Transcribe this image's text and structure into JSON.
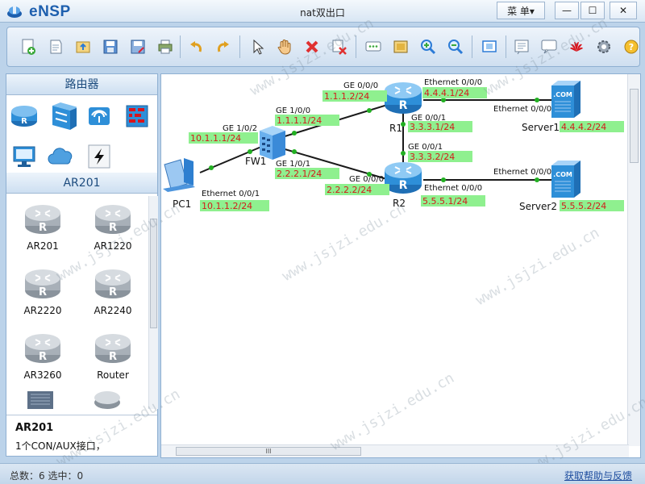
{
  "app": {
    "name": "eNSP",
    "title": "nat双出口",
    "menu_label": "菜 单▾"
  },
  "window_buttons": {
    "minimize": "—",
    "maximize": "☐",
    "close": "✕"
  },
  "toolbar": {
    "icons": [
      "new-topology-icon",
      "new-from-template-icon",
      "open-icon",
      "save-icon",
      "save-as-icon",
      "print-icon",
      "undo-icon",
      "redo-icon",
      "select-icon",
      "pan-hand-icon",
      "delete-icon",
      "delete-link-icon",
      "text-note-icon",
      "palette-icon",
      "zoom-in-icon",
      "zoom-out-icon",
      "fit-window-icon",
      "topology-grid-icon",
      "chat-icon",
      "huawei-icon",
      "settings-icon",
      "help-icon"
    ]
  },
  "left_panel": {
    "category_header": "路由器",
    "categories": [
      "router-category-icon",
      "switch-category-icon",
      "wireless-category-icon",
      "firewall-category-icon",
      "terminal-category-icon",
      "cloud-category-icon",
      "link-category-icon"
    ],
    "device_header": "AR201",
    "devices": [
      {
        "label": "AR201"
      },
      {
        "label": "AR1220"
      },
      {
        "label": "AR2220"
      },
      {
        "label": "AR2240"
      },
      {
        "label": "AR3260"
      },
      {
        "label": "Router"
      }
    ],
    "info_title": "AR201",
    "info_desc": "1个CON/AUX接口，"
  },
  "topology": {
    "nodes": {
      "pc1": "PC1",
      "fw1": "FW1",
      "r1": "R1",
      "r2": "R2",
      "server1": "Server1",
      "server2": "Server2",
      "server_badge": ".COM"
    },
    "interfaces": {
      "pc1_eth": "Ethernet 0/0/1",
      "fw1_ge102": "GE 1/0/2",
      "fw1_ge100": "GE 1/0/0",
      "fw1_ge101": "GE 1/0/1",
      "r1_ge000": "GE 0/0/0",
      "r1_eth000": "Ethernet 0/0/0",
      "r1_ge001": "GE 0/0/1",
      "r2_ge001": "GE 0/0/1",
      "r2_ge000": "GE 0/0/0",
      "r2_eth000": "Ethernet 0/0/0",
      "server1_eth": "Ethernet 0/0/0",
      "server2_eth": "Ethernet 0/0/0"
    },
    "ips": {
      "pc1": "10.1.1.2/24",
      "fw1_ge102": "10.1.1.1/24",
      "fw1_ge100": "1.1.1.1/24",
      "fw1_ge101": "2.2.2.1/24",
      "r1_ge000": "1.1.1.2/24",
      "r1_eth000": "4.4.4.1/24",
      "r1_ge001": "3.3.3.1/24",
      "r2_ge001": "3.3.3.2/24",
      "r2_ge000": "2.2.2.2/24",
      "r2_eth000": "5.5.5.1/24",
      "server1": "4.4.4.2/24",
      "server2": "5.5.5.2/24"
    }
  },
  "scrollbar": {
    "hthumb_grip": "III"
  },
  "status": {
    "text": "总数：6 选中：0",
    "help": "获取帮助与反馈"
  },
  "watermark": "www.jsjzi.edu.cn",
  "colors": {
    "ip_label_bg": "#8ff08f",
    "ip_label_text": "#d21b1b",
    "router_blue": "#2e8fd8",
    "link": "#1a1a1a",
    "link_dot": "#22b022"
  }
}
